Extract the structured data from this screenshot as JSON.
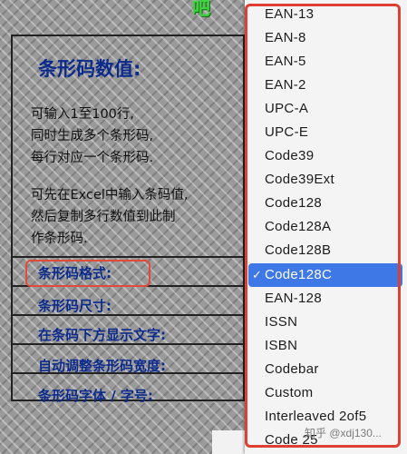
{
  "panel": {
    "title": "条形码数值:",
    "desc_1": [
      "可输入1至100行,",
      "同时生成多个条形码,",
      "每行对应一个条形码."
    ],
    "desc_2": [
      "可先在Excel中输入条码值,",
      "然后复制多行数值到此制",
      "作条形码."
    ]
  },
  "rows": [
    "条形码格式:",
    "条形码尺寸:",
    "在条码下方显示文字:",
    "自动调整条形码宽度:",
    "条形码字体 / 字号:"
  ],
  "dropdown": {
    "items": [
      "EAN-13",
      "EAN-8",
      "EAN-5",
      "EAN-2",
      "UPC-A",
      "UPC-E",
      "Code39",
      "Code39Ext",
      "Code128",
      "Code128A",
      "Code128B",
      "Code128C",
      "EAN-128",
      "ISSN",
      "ISBN",
      "Codebar",
      "Custom",
      "Interleaved 2of5",
      "Code 25"
    ],
    "selected": "Code128C",
    "check_mark": "✓"
  },
  "watermark": "知乎 @xdj130..."
}
